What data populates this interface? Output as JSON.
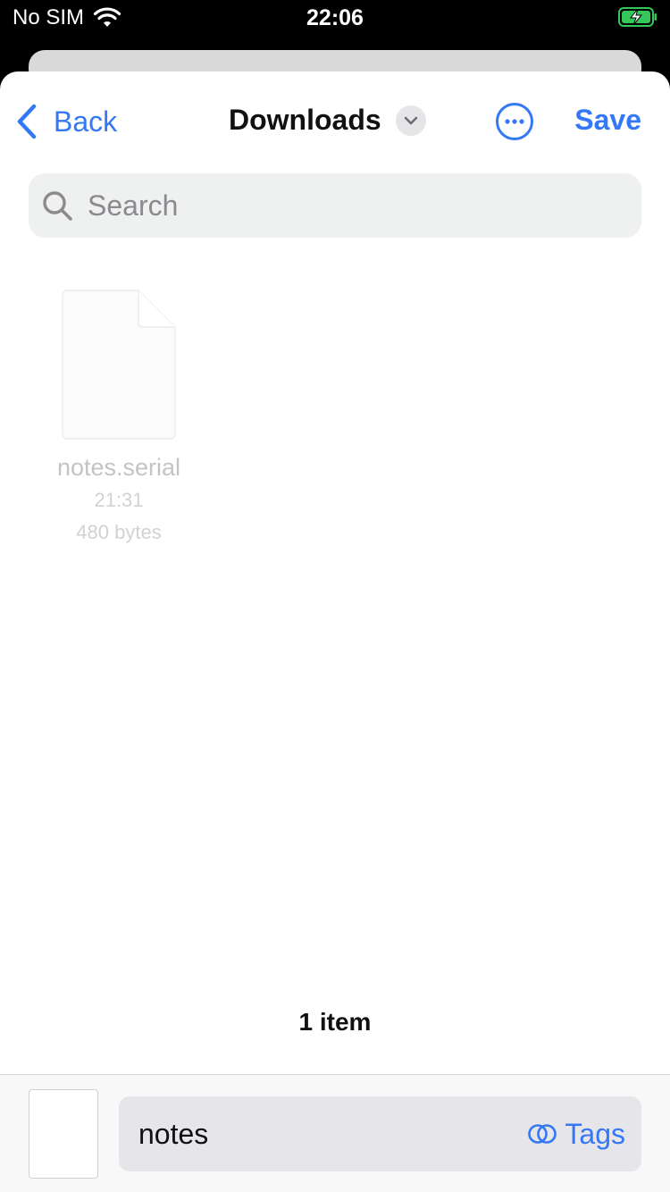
{
  "status": {
    "carrier": "No SIM",
    "time": "22:06",
    "battery_color": "#34c759"
  },
  "nav": {
    "back_label": "Back",
    "title": "Downloads",
    "save_label": "Save"
  },
  "search": {
    "placeholder": "Search",
    "value": ""
  },
  "file": {
    "name": "notes.serial",
    "time": "21:31",
    "size": "480 bytes"
  },
  "footer": {
    "item_count": "1 item"
  },
  "bottom": {
    "filename_value": "notes",
    "tags_label": "Tags"
  },
  "colors": {
    "accent": "#3478f6"
  },
  "icons": [
    "wifi-icon",
    "battery-charging-icon",
    "chevron-left-icon",
    "chevron-down-icon",
    "more-icon",
    "search-icon",
    "document-icon",
    "tags-icon"
  ]
}
